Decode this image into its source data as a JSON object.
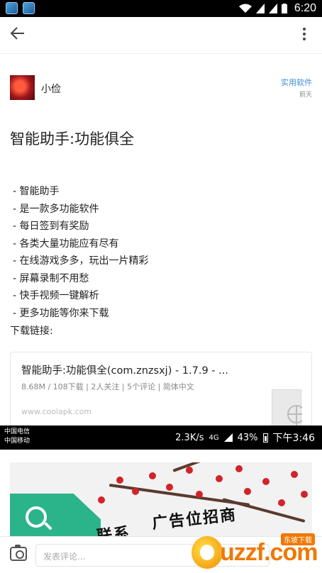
{
  "status_bar": {
    "time": "6:20"
  },
  "post": {
    "author_name": "小俭",
    "category_tag": "实用软件",
    "posted_time": "前天",
    "title": "智能助手:功能俱全",
    "features": [
      "- 智能助手",
      "- 是一款多功能软件",
      "- 每日签到有奖励",
      "- 各类大量功能应有尽有",
      "- 在线游戏多多，玩出一片精彩",
      "- 屏幕录制不用愁",
      "- 快手视频一键解析",
      "- 更多功能等你来下载"
    ],
    "download_label": "下载链接:"
  },
  "link_card": {
    "title": "智能助手:功能俱全(com.znzsxj) - 1.7.9 - ...",
    "meta": "8.68M / 108下载 | 2人关注 | 5个评论 | 简体中文",
    "url": "www.coolapk.com"
  },
  "overlay_status": {
    "carrier_line1": "中国电信",
    "carrier_line2": "中国移动",
    "speed": "2.3K/s",
    "network": "4G",
    "battery": "43%",
    "time": "下午3:46"
  },
  "banner": {
    "text_line1": "广告位招商",
    "text_line2": "联系"
  },
  "comment_bar": {
    "placeholder": "发表评论..."
  },
  "watermark": {
    "text": "uzzf.com",
    "badge": "东坡下载"
  }
}
